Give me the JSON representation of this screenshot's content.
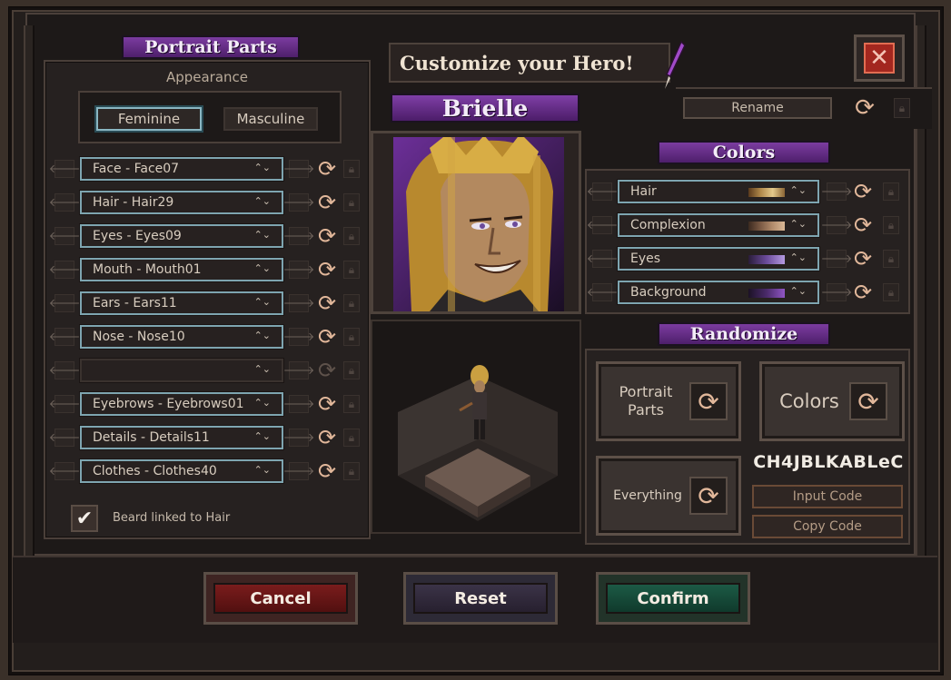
{
  "header": {
    "title": "Customize your Hero!",
    "close_icon": "close-icon"
  },
  "hero": {
    "name": "Brielle",
    "rename_label": "Rename"
  },
  "portrait_parts": {
    "title": "Portrait Parts",
    "appearance_label": "Appearance",
    "gender_options": [
      "Feminine",
      "Masculine"
    ],
    "selected_gender": "Feminine",
    "parts": [
      {
        "label": "Face - Face07",
        "enabled": true
      },
      {
        "label": "Hair - Hair29",
        "enabled": true
      },
      {
        "label": "Eyes - Eyes09",
        "enabled": true
      },
      {
        "label": "Mouth - Mouth01",
        "enabled": true
      },
      {
        "label": "Ears - Ears11",
        "enabled": true
      },
      {
        "label": "Nose - Nose10",
        "enabled": true
      },
      {
        "label": "",
        "enabled": false
      },
      {
        "label": "Eyebrows - Eyebrows01",
        "enabled": true
      },
      {
        "label": "Details - Details11",
        "enabled": true
      },
      {
        "label": "Clothes - Clothes40",
        "enabled": true
      }
    ],
    "beard_checkbox": {
      "label": "Beard linked to Hair",
      "checked": true
    }
  },
  "colors": {
    "title": "Colors",
    "rows": [
      {
        "label": "Hair",
        "swatch": [
          "#5a3a1c",
          "#b0884a",
          "#e3c98c",
          "#8a6434"
        ]
      },
      {
        "label": "Complexion",
        "swatch": [
          "#3c2a20",
          "#7b5a44",
          "#b38c6c",
          "#d9b896"
        ]
      },
      {
        "label": "Eyes",
        "swatch": [
          "#2a1d3a",
          "#6b4b9a",
          "#b49ae0"
        ]
      },
      {
        "label": "Background",
        "swatch": [
          "#1c1226",
          "#4a2a6a",
          "#9056c4"
        ]
      }
    ]
  },
  "randomize": {
    "title": "Randomize",
    "portrait_parts_label": "Portrait Parts",
    "colors_label": "Colors",
    "everything_label": "Everything",
    "code": "CH4JBLKABLeC",
    "input_code_label": "Input Code",
    "copy_code_label": "Copy Code"
  },
  "actions": {
    "cancel": "Cancel",
    "reset": "Reset",
    "confirm": "Confirm"
  },
  "accent_colors": {
    "ribbon_purple": "#6a2c8c",
    "select_border": "#7ea5b0",
    "cancel_red": "#7a1c1c",
    "confirm_green": "#1c5a45"
  }
}
